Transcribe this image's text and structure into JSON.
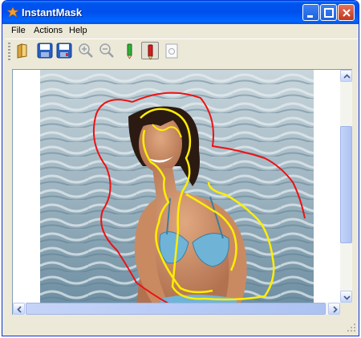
{
  "window": {
    "title": "InstantMask"
  },
  "menu": {
    "items": [
      "File",
      "Actions",
      "Help"
    ]
  },
  "toolbar": {
    "tools": [
      "open-icon",
      "save-icon",
      "save-as-icon",
      "zoom-in-icon",
      "zoom-out-icon",
      "green-marker-icon",
      "red-marker-icon",
      "preview-icon"
    ],
    "active_tool": "red-marker-icon"
  },
  "colors": {
    "foreground_stroke": "#ffff00",
    "background_stroke": "#ee1111",
    "title_bar": "#0053ee"
  }
}
